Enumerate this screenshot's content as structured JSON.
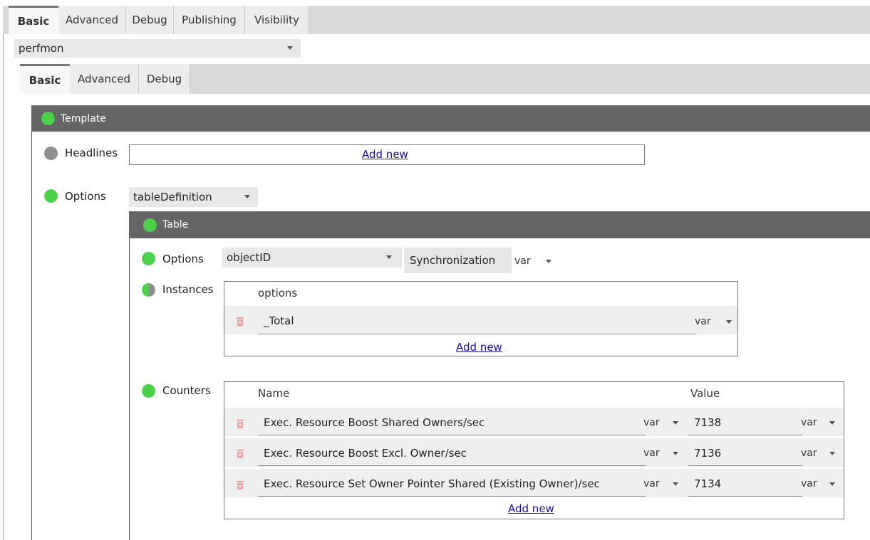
{
  "outer_tabs": [
    "Basic",
    "Advanced",
    "Debug",
    "Publishing",
    "Visibility"
  ],
  "plugin_select": "perfmon",
  "inner_tabs": [
    "Basic",
    "Advanced",
    "Debug"
  ],
  "template_panel": {
    "title": "Template"
  },
  "headlines": {
    "label": "Headlines",
    "add_new": "Add new"
  },
  "options": {
    "label": "Options",
    "value": "tableDefinition"
  },
  "table_panel": {
    "title": "Table",
    "options_label": "Options",
    "options_value": "objectID",
    "sync_button": "Synchronization",
    "sync_var": "var"
  },
  "instances": {
    "label": "Instances",
    "header": "options",
    "rows": [
      {
        "value": "_Total",
        "var": "var"
      }
    ],
    "add_new": "Add new"
  },
  "counters": {
    "label": "Counters",
    "name_header": "Name",
    "value_header": "Value",
    "rows": [
      {
        "name": "Exec. Resource Boost Shared Owners/sec",
        "name_var": "var",
        "value": "7138",
        "value_var": "var"
      },
      {
        "name": "Exec. Resource Boost Excl. Owner/sec",
        "name_var": "var",
        "value": "7136",
        "value_var": "var"
      },
      {
        "name": "Exec. Resource Set Owner Pointer Shared (Existing Owner)/sec",
        "name_var": "var",
        "value": "7134",
        "value_var": "var"
      }
    ],
    "add_new": "Add new"
  },
  "colors": {
    "status_green": "#4cd14c",
    "status_gray": "#8e8e8e",
    "header_dark": "#656565",
    "link": "#1a0dab"
  }
}
